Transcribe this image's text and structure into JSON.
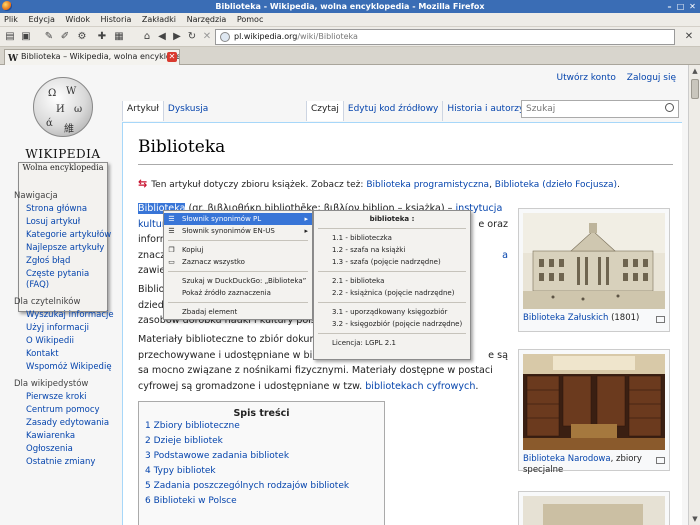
{
  "window": {
    "title": "Biblioteka - Wikipedia, wolna encyklopedia - Mozilla Firefox"
  },
  "menubar": [
    "Plik",
    "Edycja",
    "Widok",
    "Historia",
    "Zakładki",
    "Narzędzia",
    "Pomoc"
  ],
  "url": {
    "domain": "pl.wikipedia.org",
    "path": "/wiki/Biblioteka"
  },
  "tab": {
    "title": "Biblioteka – Wikipedia, wolna encyklopedia"
  },
  "userlinks": {
    "create": "Utwórz konto",
    "login": "Zaloguj się"
  },
  "logo": {
    "wordmark": "WIKIPEDIA",
    "tagline": "Wolna encyklopedia"
  },
  "sidebar": {
    "nav_title": "Nawigacja",
    "nav": [
      "Strona główna",
      "Losuj artykuł",
      "Kategorie artykułów",
      "Najlepsze artykuły",
      "Zgłoś błąd",
      "Częste pytania (FAQ)"
    ],
    "readers_title": "Dla czytelników",
    "readers": [
      "Wyszukaj informacje",
      "Użyj informacji",
      "O Wikipedii",
      "Kontakt",
      "Wspomóż Wikipedię"
    ],
    "editors_title": "Dla wikipedystów",
    "editors": [
      "Pierwsze kroki",
      "Centrum pomocy",
      "Zasady edytowania",
      "Kawiarenka",
      "Ogłoszenia",
      "Ostatnie zmiany"
    ]
  },
  "pagetabs": {
    "article": "Artykuł",
    "talk": "Dyskusja",
    "read": "Czytaj",
    "edit": "Edytuj kod źródłowy",
    "history": "Historia i autorzy"
  },
  "search": {
    "placeholder": "Szukaj"
  },
  "article": {
    "title": "Biblioteka",
    "hatnote_text": "Ten artykuł dotyczy zbioru książek. Zobacz też:",
    "hatnote_link1": "Biblioteka programistyczna",
    "hatnote_link2": "Biblioteka (dzieło Focjusza)",
    "p1_sel": "Biblioteka",
    "p1_a": " (gr. βιβλιοθήκη bibliothēke; βιβλίον biblion – książka) – ",
    "p1_link": "instytucja",
    "p1_l2a": "kultur",
    "p1_l2b": "e oraz",
    "p1_l3": "inform",
    "p1_l4a": "znacz",
    "p1_l4b": "a",
    "p1_l5": "zawie",
    "p2_l1": "Biblio",
    "p2_l2": "dzied",
    "p2_l3": "zasobów dorobku nauki i kultury polsk",
    "p3_l1": "Materiały biblioteczne to zbiór dokum",
    "p3_l2a": "przechowywane i udostępniane w bibliotekach.",
    "p3_l2b": "e są",
    "p3_l3": "sa mocno związane z nośnikami fizycznymi. Materiały dostępne w postaci",
    "p3_l4a": "cyfrowej są gromadzone i udostępniane w tzw.",
    "p3_l4b": "bibliotekach cyfrowych"
  },
  "toc": {
    "title": "Spis treści",
    "items": [
      "1 Zbiory biblioteczne",
      "2 Dzieje bibliotek",
      "3 Podstawowe zadania bibliotek",
      "4 Typy bibliotek",
      "5 Zadania poszczególnych rodzajów bibliotek",
      "6 Biblioteki w Polsce"
    ]
  },
  "images": {
    "cap1_link": "Biblioteka Załuskich",
    "cap1_rest": " (1801)",
    "cap2_link": "Biblioteka Narodowa",
    "cap2_rest": ", zbiory specjalne"
  },
  "context_menu": {
    "items": [
      "Słownik synonimów PL",
      "Słownik synonimów EN-US",
      "Kopiuj",
      "Zaznacz wszystko",
      "Szukaj w DuckDuckGo: „Biblioteka”",
      "Pokaż źródło zaznaczenia",
      "Zbadaj element"
    ]
  },
  "submenu": {
    "header": "biblioteka :",
    "rows": [
      "1.1 - biblioteczka",
      "1.2 - szafa na książki",
      "1.3 - szafa (pojęcie nadrzędne)",
      "2.1 - biblioteka",
      "2.2 - książnica (pojęcie nadrzędne)",
      "3.1 - uporządkowany księgozbiór",
      "3.2 - księgozbiór (pojęcie nadrzędne)",
      "Licencja: LGPL 2.1"
    ]
  }
}
